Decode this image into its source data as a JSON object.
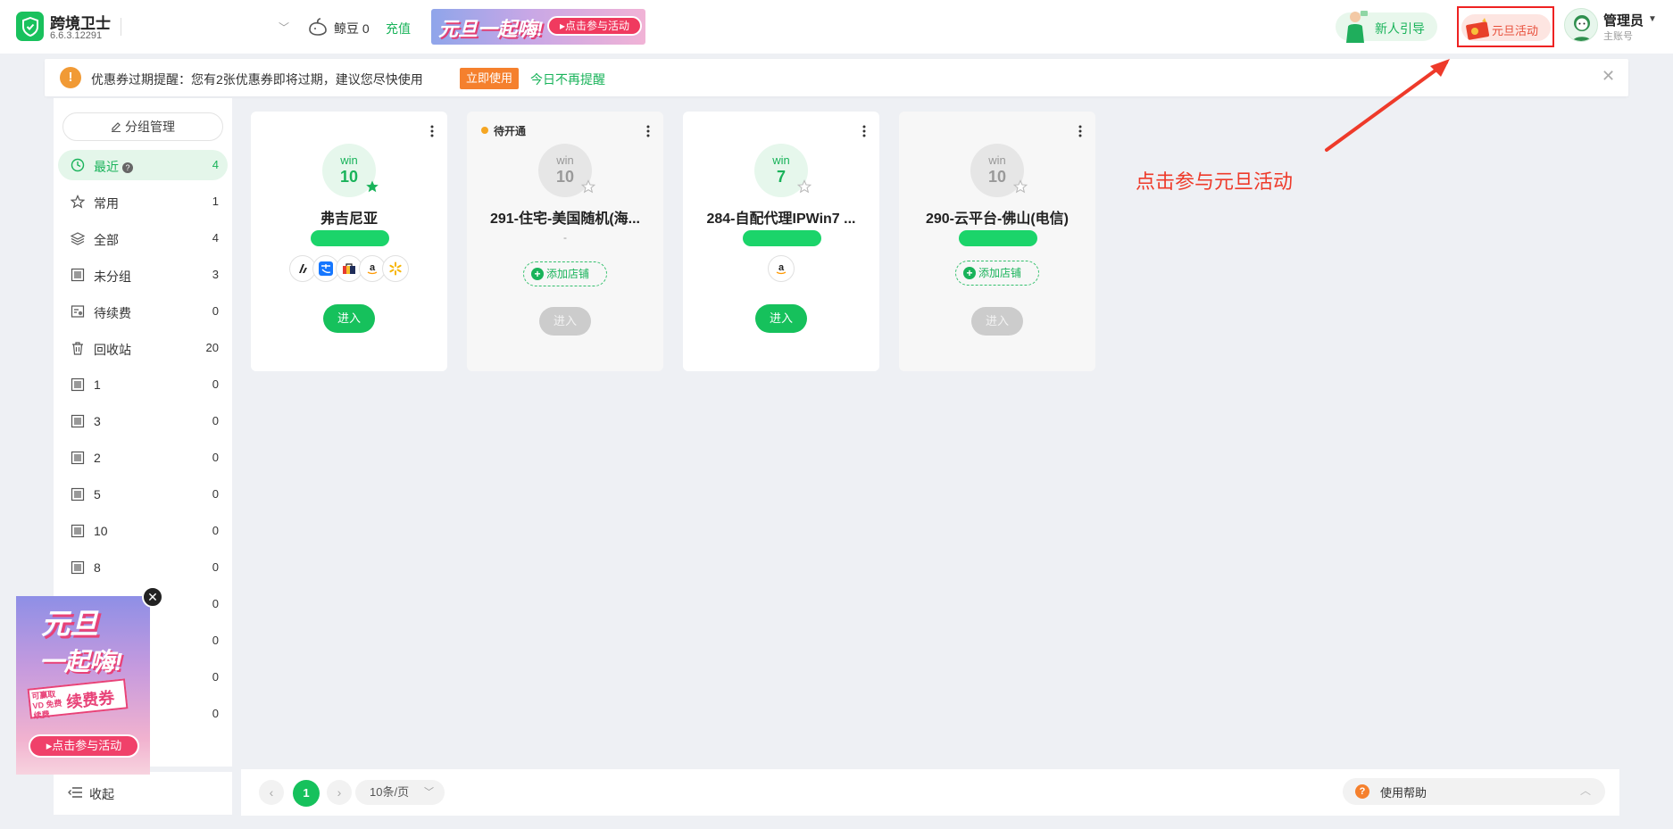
{
  "app": {
    "name": "跨境卫士",
    "version": "6.6.3.12291"
  },
  "topbar": {
    "bean_text": "鲸豆 0",
    "recharge": "充值",
    "banner_title": "元旦一起嗨!",
    "banner_button": "▸点击参与活动",
    "newbie_guide": "新人引导",
    "activity": "元旦活动",
    "user_name": "管理员",
    "user_role": "主账号"
  },
  "notice": {
    "text": "优惠券过期提醒：您有2张优惠券即将过期，建议您尽快使用",
    "use_now": "立即使用",
    "no_remind": "今日不再提醒",
    "close": "✕"
  },
  "sidebar": {
    "group_manage": "分组管理",
    "items": [
      {
        "label": "最近",
        "count": "4",
        "icon": "clock-icon",
        "active": true
      },
      {
        "label": "常用",
        "count": "1",
        "icon": "star-outline-icon"
      },
      {
        "label": "全部",
        "count": "4",
        "icon": "layers-icon"
      },
      {
        "label": "未分组",
        "count": "3",
        "icon": "group-icon"
      },
      {
        "label": "待续费",
        "count": "0",
        "icon": "renew-icon"
      },
      {
        "label": "回收站",
        "count": "20",
        "icon": "trash-icon"
      },
      {
        "label": "1",
        "count": "0",
        "icon": "group-icon"
      },
      {
        "label": "3",
        "count": "0",
        "icon": "group-icon"
      },
      {
        "label": "2",
        "count": "0",
        "icon": "group-icon"
      },
      {
        "label": "5",
        "count": "0",
        "icon": "group-icon"
      },
      {
        "label": "10",
        "count": "0",
        "icon": "group-icon"
      },
      {
        "label": "8",
        "count": "0",
        "icon": "group-icon"
      },
      {
        "label": "",
        "count": "0",
        "icon": "group-icon"
      },
      {
        "label": "",
        "count": "0",
        "icon": "group-icon"
      },
      {
        "label": "",
        "count": "0",
        "icon": "group-icon"
      },
      {
        "label": "",
        "count": "0",
        "icon": "group-icon"
      }
    ],
    "collapse": "收起"
  },
  "cards": [
    {
      "os_name": "win",
      "os_ver": "10",
      "name": "弗吉尼亚",
      "status": "",
      "enter": "进入",
      "starred": true,
      "shops": [
        "shopify-icon",
        "alipay-icon",
        "shop-icon",
        "amazon-icon",
        "walmart-icon"
      ]
    },
    {
      "os_name": "win",
      "os_ver": "10",
      "name": "291-住宅-美国随机(海...",
      "status": "待开通",
      "enter": "进入",
      "dash": "-",
      "add_shop": "添加店铺"
    },
    {
      "os_name": "win",
      "os_ver": "7",
      "name": "284-自配代理IPWin7 ...",
      "status": "",
      "enter": "进入",
      "shops": [
        "amazon-icon"
      ]
    },
    {
      "os_name": "win",
      "os_ver": "10",
      "name": "290-云平台-佛山(电信)",
      "status": "",
      "enter": "进入",
      "add_shop": "添加店铺"
    }
  ],
  "annotation": "点击参与元旦活动",
  "pager": {
    "current": "1",
    "page_size": "10条/页",
    "prev": "‹",
    "next": "›",
    "help": "使用帮助"
  },
  "promo": {
    "title1": "元旦",
    "title2": "一起嗨!",
    "sub_small": "可赢取VD 免费续费",
    "sub_big": "续费券",
    "button": "▸点击参与活动",
    "close": "✕"
  },
  "colors": {
    "brand_green": "#16c15c",
    "warning_orange": "#f5802d",
    "annotation_red": "#ee3a2a"
  }
}
